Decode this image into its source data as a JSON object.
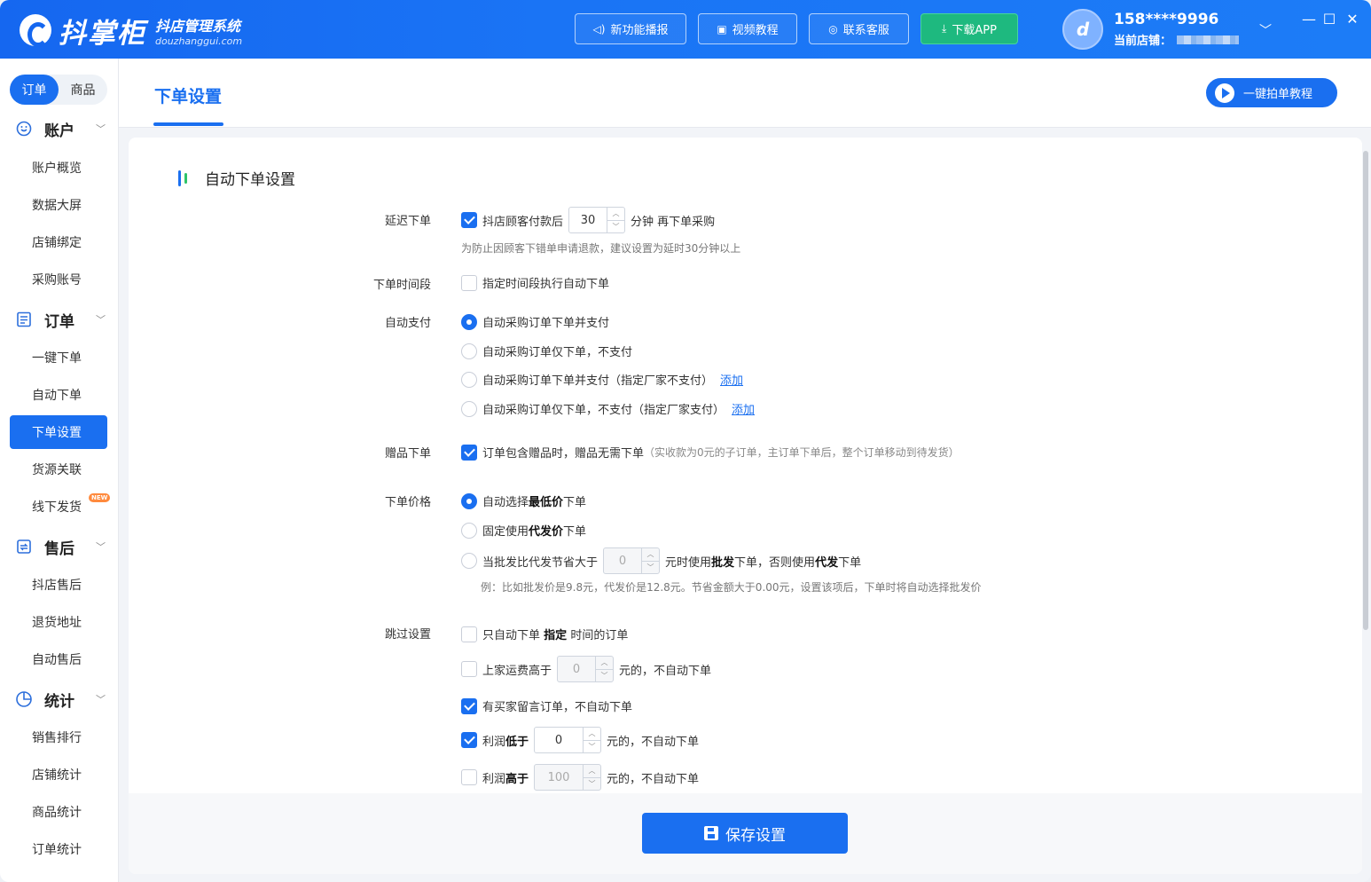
{
  "app": {
    "name": "抖掌柜",
    "subtitle": "抖店管理系统",
    "domain": "douzhanggui.com"
  },
  "topbar": {
    "buttons": [
      {
        "label": "新功能播报",
        "icon": "speaker-icon"
      },
      {
        "label": "视频教程",
        "icon": "video-icon"
      },
      {
        "label": "联系客服",
        "icon": "headset-icon"
      },
      {
        "label": "下载APP",
        "icon": "download-icon"
      }
    ],
    "user": {
      "phone": "158****9996",
      "store_label": "当前店铺："
    }
  },
  "sidebar": {
    "tabs": [
      "订单",
      "商品"
    ],
    "groups": [
      {
        "title": "账户",
        "icon": "account-icon",
        "items": [
          "账户概览",
          "数据大屏",
          "店铺绑定",
          "采购账号"
        ]
      },
      {
        "title": "订单",
        "icon": "order-icon",
        "items": [
          "一键下单",
          "自动下单",
          "下单设置",
          "货源关联",
          "线下发货"
        ]
      },
      {
        "title": "售后",
        "icon": "aftersale-icon",
        "items": [
          "抖店售后",
          "退货地址",
          "自动售后"
        ]
      },
      {
        "title": "统计",
        "icon": "stats-icon",
        "items": [
          "销售排行",
          "店铺统计",
          "商品统计",
          "订单统计"
        ]
      }
    ],
    "active_item": "下单设置",
    "new_badge": "NEW"
  },
  "page": {
    "title": "下单设置",
    "tutorial_button": "一键拍单教程"
  },
  "section": {
    "title": "自动下单设置"
  },
  "settings": {
    "delay": {
      "label": "延迟下单",
      "text_before": "抖店顾客付款后",
      "value": "30",
      "text_after": "分钟 再下单采购",
      "hint": "为防止因顾客下错单申请退款，建议设置为延时30分钟以上",
      "checked": true
    },
    "timeslot": {
      "label": "下单时间段",
      "text": "指定时间段执行自动下单",
      "checked": false
    },
    "autopay": {
      "label": "自动支付",
      "options": [
        "自动采购订单下单并支付",
        "自动采购订单仅下单，不支付",
        "自动采购订单下单并支付（指定厂家不支付）",
        "自动采购订单仅下单，不支付（指定厂家支付）"
      ],
      "selected": 0,
      "add_link": "添加"
    },
    "gift": {
      "label": "赠品下单",
      "text": "订单包含赠品时，赠品无需下单",
      "note": "（实收款为0元的子订单，主订单下单后，整个订单移动到待发货）",
      "checked": true
    },
    "price": {
      "label": "下单价格",
      "opt1": {
        "pre": "自动选择",
        "bold": "最低价",
        "post": "下单"
      },
      "opt2": {
        "pre": "固定使用",
        "bold": "代发价",
        "post": "下单"
      },
      "opt3": {
        "pre": "当批发比代发节省大于",
        "value": "0",
        "mid": "元时使用",
        "bold1": "批发",
        "mid2": "下单，否则使用",
        "bold2": "代发",
        "post": "下单"
      },
      "selected": 0,
      "hint": "例：比如批发价是9.8元，代发价是12.8元。节省金额大于0.00元，设置该项后，下单时将自动选择批发价"
    },
    "skip": {
      "label": "跳过设置",
      "only_time": {
        "pre": "只自动下单",
        "bold": "指定",
        "post": "时间的订单",
        "checked": false
      },
      "freight": {
        "pre": "上家运费高于",
        "value": "0",
        "post": "元的，不自动下单",
        "checked": false
      },
      "buyer_msg": {
        "text": "有买家留言订单，不自动下单",
        "checked": true
      },
      "profit_low": {
        "pre": "利润",
        "bold": "低于",
        "value": "0",
        "post": "元的，不自动下单",
        "checked": true
      },
      "profit_high": {
        "pre": "利润",
        "bold": "高于",
        "value": "100",
        "post": "元的，不自动下单",
        "checked": false
      }
    }
  },
  "footer": {
    "save_label": "保存设置"
  }
}
